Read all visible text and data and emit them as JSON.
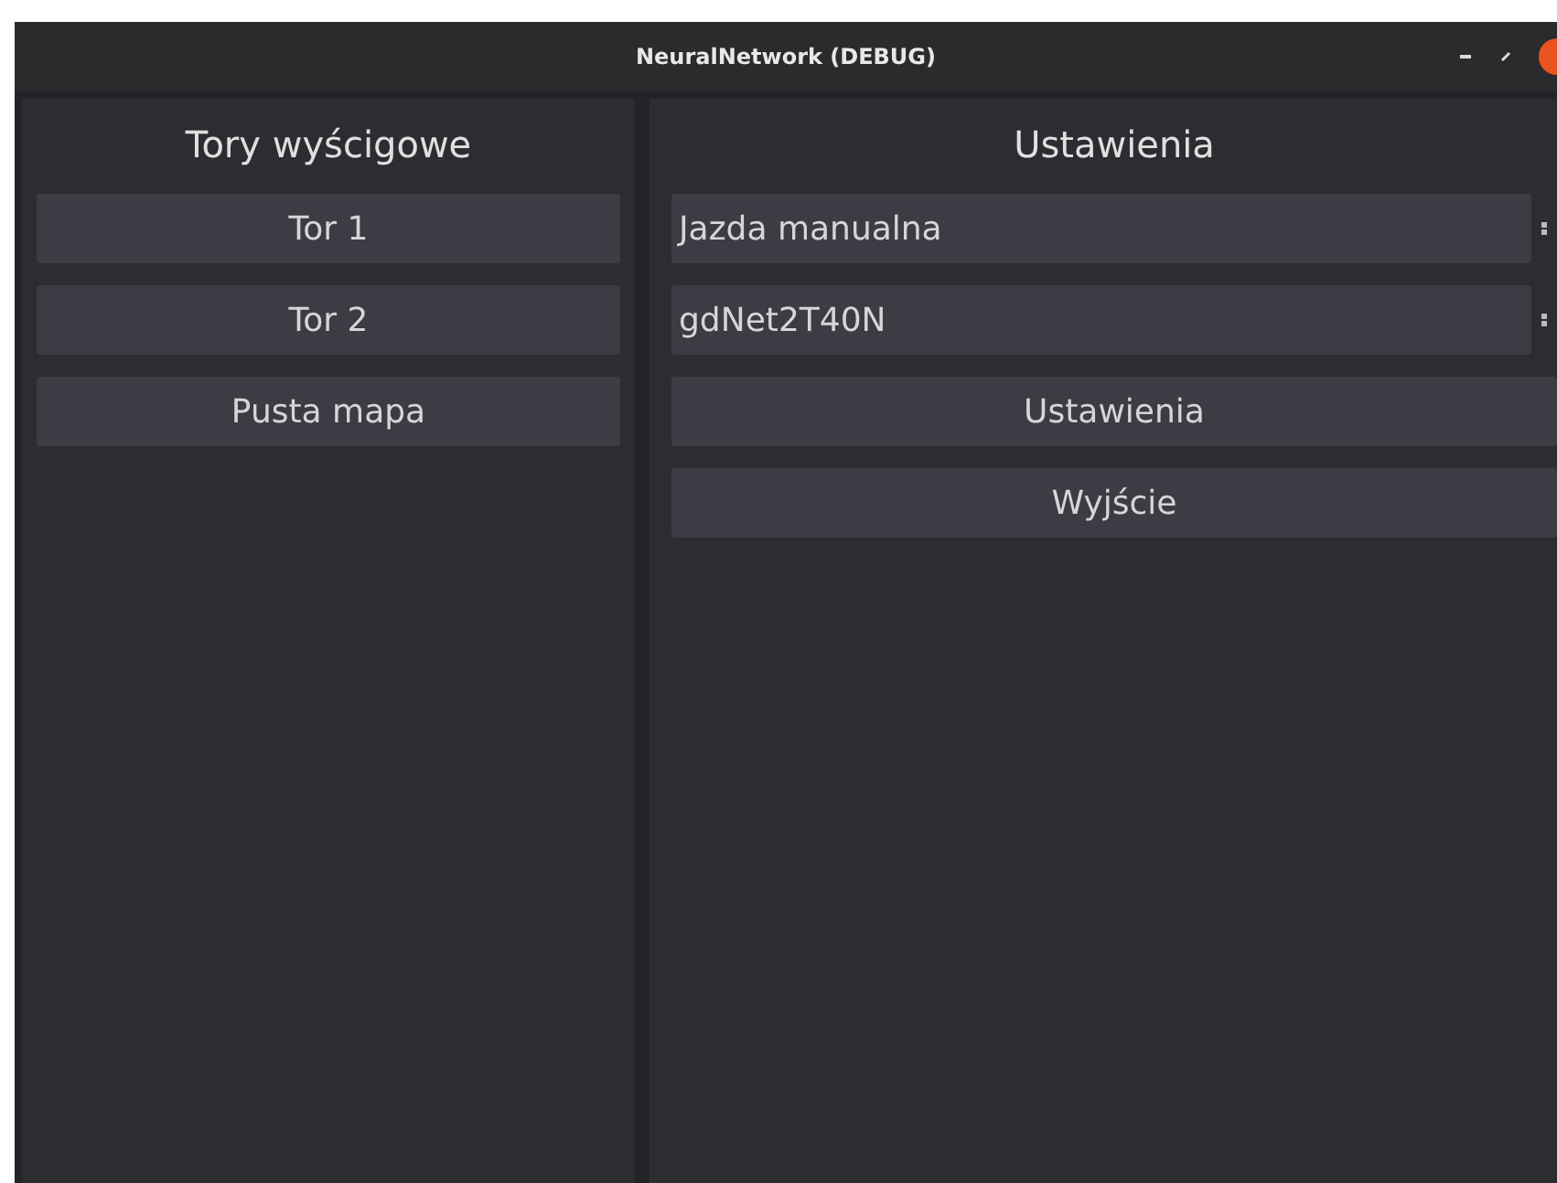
{
  "window": {
    "title": "NeuralNetwork (DEBUG)"
  },
  "left_panel": {
    "title": "Tory wyścigowe",
    "buttons": [
      "Tor 1",
      "Tor 2",
      "Pusta mapa"
    ]
  },
  "right_panel": {
    "title": "Ustawienia",
    "selects": [
      {
        "value": "Jazda manualna"
      },
      {
        "value": "gdNet2T40N"
      }
    ],
    "buttons": [
      "Ustawienia",
      "Wyjście"
    ]
  }
}
